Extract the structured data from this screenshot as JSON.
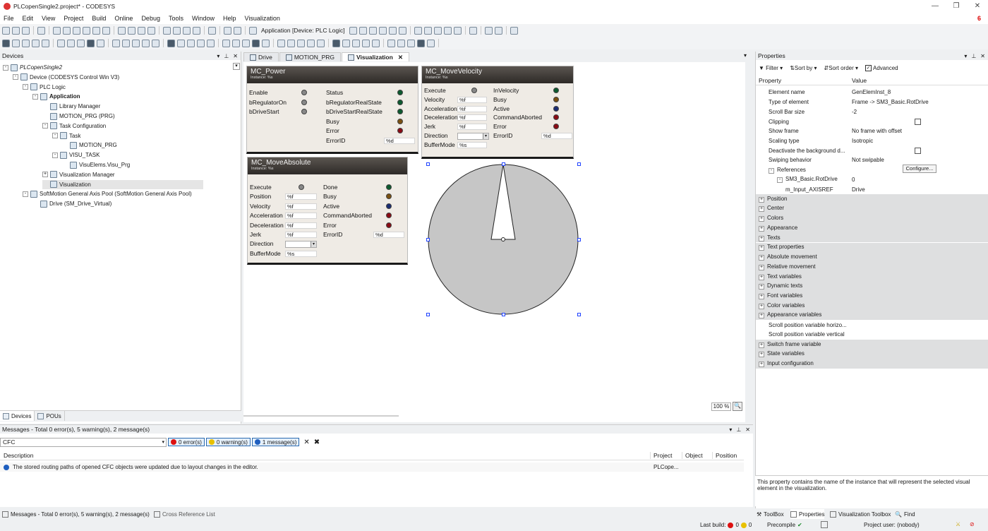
{
  "window": {
    "title": "PLCopenSingle2.project* - CODESYS"
  },
  "menu": [
    "File",
    "Edit",
    "View",
    "Project",
    "Build",
    "Online",
    "Debug",
    "Tools",
    "Window",
    "Help",
    "Visualization"
  ],
  "error_badge": "6",
  "toolbar": {
    "device_selector": "Application [Device: PLC Logic]"
  },
  "devices_panel": {
    "title": "Devices",
    "tabs": [
      "Devices",
      "POUs"
    ]
  },
  "tree": [
    {
      "label": "PLCopenSingle2",
      "depth": 0,
      "toggle": "-",
      "italic": true
    },
    {
      "label": "Device (CODESYS Control Win V3)",
      "depth": 1,
      "toggle": "-"
    },
    {
      "label": "PLC Logic",
      "depth": 2,
      "toggle": "-"
    },
    {
      "label": "Application",
      "depth": 3,
      "toggle": "-",
      "bold": true
    },
    {
      "label": "Library Manager",
      "depth": 4,
      "toggle": ""
    },
    {
      "label": "MOTION_PRG (PRG)",
      "depth": 4,
      "toggle": ""
    },
    {
      "label": "Task Configuration",
      "depth": 4,
      "toggle": "-"
    },
    {
      "label": "Task",
      "depth": 5,
      "toggle": "-"
    },
    {
      "label": "MOTION_PRG",
      "depth": 6,
      "toggle": ""
    },
    {
      "label": "VISU_TASK",
      "depth": 5,
      "toggle": "-"
    },
    {
      "label": "VisuElems.Visu_Prg",
      "depth": 6,
      "toggle": ""
    },
    {
      "label": "Visualization Manager",
      "depth": 4,
      "toggle": "+"
    },
    {
      "label": "Visualization",
      "depth": 4,
      "toggle": "",
      "selected": true
    },
    {
      "label": "SoftMotion General Axis Pool (SoftMotion General Axis Pool)",
      "depth": 2,
      "toggle": "-"
    },
    {
      "label": "Drive (SM_Drive_Virtual)",
      "depth": 3,
      "toggle": ""
    }
  ],
  "editor_tabs": [
    {
      "label": "Drive",
      "active": false
    },
    {
      "label": "MOTION_PRG",
      "active": false
    },
    {
      "label": "Visualization",
      "active": true
    }
  ],
  "visu": {
    "mc_power": {
      "title": "MC_Power",
      "subtitle": "Instance: %s",
      "inputs": [
        "Enable",
        "bRegulatorOn",
        "bDriveStart"
      ],
      "outputs": [
        "Status",
        "bRegulatorRealState",
        "bDriveStartRealState",
        "Busy",
        "Error",
        "ErrorID"
      ],
      "errorid_value": "%d",
      "output_leds": [
        "green",
        "green",
        "green",
        "brown",
        "red"
      ]
    },
    "mc_movevelocity": {
      "title": "MC_MoveVelocity",
      "subtitle": "Instance: %s",
      "inputs": [
        "Execute",
        "Velocity",
        "Acceleration",
        "Deceleration",
        "Jerk",
        "Direction",
        "BufferMode"
      ],
      "input_values": [
        "",
        "%f",
        "%f",
        "%f",
        "%f",
        "",
        "%s"
      ],
      "outputs": [
        "InVelocity",
        "Busy",
        "Active",
        "CommandAborted",
        "Error",
        "ErrorID"
      ],
      "output_leds": [
        "green",
        "brown",
        "blue",
        "red",
        "red"
      ],
      "errorid_value": "%d"
    },
    "mc_moveabsolute": {
      "title": "MC_MoveAbsolute",
      "subtitle": "Instance: %s",
      "inputs": [
        "Execute",
        "Position",
        "Velocity",
        "Acceleration",
        "Deceleration",
        "Jerk",
        "Direction",
        "BufferMode"
      ],
      "input_values": [
        "",
        "%f",
        "%f",
        "%f",
        "%f",
        "%f",
        "",
        "%s"
      ],
      "outputs": [
        "Done",
        "Busy",
        "Active",
        "CommandAborted",
        "Error",
        "ErrorID"
      ],
      "output_leds": [
        "green",
        "brown",
        "blue",
        "red",
        "red"
      ],
      "errorid_value": "%d"
    }
  },
  "zoom": "100 %",
  "properties": {
    "title": "Properties",
    "toolbar": {
      "filter": "Filter",
      "sort_by": "Sort by",
      "sort_order": "Sort order",
      "advanced": "Advanced"
    },
    "columns": [
      "Property",
      "Value"
    ],
    "rows": [
      {
        "name": "Element name",
        "value": "GenElemInst_8"
      },
      {
        "name": "Type of element",
        "value": "Frame -> SM3_Basic.RotDrive"
      },
      {
        "name": "Scroll Bar size",
        "value": "-2"
      },
      {
        "name": "Clipping",
        "value": "",
        "checkbox": true
      },
      {
        "name": "Show frame",
        "value": "No frame with offset"
      },
      {
        "name": "Scaling type",
        "value": "Isotropic"
      },
      {
        "name": "Deactivate the background d...",
        "value": "",
        "checkbox": true
      },
      {
        "name": "Swiping behavior",
        "value": "Not swipable"
      },
      {
        "name": "References",
        "value": "",
        "toggle": "-",
        "button": "Configure..."
      },
      {
        "name": "SM3_Basic.RotDrive",
        "value": "0",
        "toggle": "-",
        "indent": 1
      },
      {
        "name": "m_Input_AXISREF",
        "value": "Drive",
        "indent": 2
      },
      {
        "name": "Position",
        "group": true
      },
      {
        "name": "Center",
        "group": true
      },
      {
        "name": "Colors",
        "group": true
      },
      {
        "name": "Appearance",
        "group": true
      },
      {
        "name": "Texts",
        "group": true
      },
      {
        "name": "Text properties",
        "group": true
      },
      {
        "name": "Absolute movement",
        "group": true
      },
      {
        "name": "Relative movement",
        "group": true
      },
      {
        "name": "Text variables",
        "group": true
      },
      {
        "name": "Dynamic texts",
        "group": true
      },
      {
        "name": "Font variables",
        "group": true
      },
      {
        "name": "Color variables",
        "group": true
      },
      {
        "name": "Appearance variables",
        "group": true
      },
      {
        "name": "Scroll position variable horizo...",
        "value": ""
      },
      {
        "name": "Scroll position variable vertical",
        "value": ""
      },
      {
        "name": "Switch frame variable",
        "group": true
      },
      {
        "name": "State variables",
        "group": true
      },
      {
        "name": "Input configuration",
        "group": true
      }
    ],
    "description": "This property contains the name of the instance that will represent the selected visual element in the visualization."
  },
  "messages": {
    "title": "Messages - Total 0 error(s), 5 warning(s), 2 message(s)",
    "source": "CFC",
    "filters": [
      "0 error(s)",
      "0 warning(s)",
      "1 message(s)"
    ],
    "columns": [
      "Description",
      "Project",
      "Object",
      "Position"
    ],
    "rows": [
      {
        "description": "The stored routing paths of opened CFC objects were updated due to layout changes in the editor.",
        "project": "PLCope...",
        "object": "",
        "position": ""
      }
    ]
  },
  "bottom_tabs_left": [
    "Messages - Total 0 error(s), 5 warning(s), 2 message(s)",
    "Cross Reference List"
  ],
  "bottom_tabs_right": [
    "ToolBox",
    "Properties",
    "Visualization Toolbox",
    "Find"
  ],
  "status": {
    "last_build": "Last build:",
    "last_build_errors": "0",
    "last_build_warnings": "0",
    "precompile": "Precompile",
    "project_user": "Project user: (nobody)"
  }
}
